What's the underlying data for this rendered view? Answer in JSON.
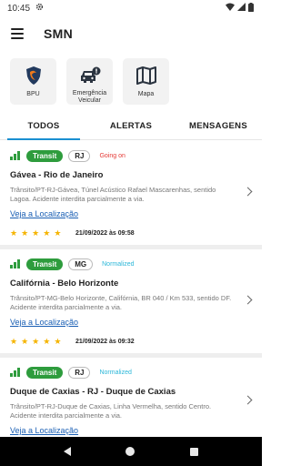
{
  "status_bar": {
    "time": "10:45"
  },
  "app": {
    "title": "SMN"
  },
  "shortcuts": [
    {
      "label": "BPU",
      "icon": "bpu-shield-icon"
    },
    {
      "label": "Emergência Veicular",
      "icon": "car-alert-icon"
    },
    {
      "label": "Mapa",
      "icon": "map-icon"
    }
  ],
  "tabs": [
    {
      "label": "TODOS",
      "active": true
    },
    {
      "label": "ALERTAS",
      "active": false
    },
    {
      "label": "MENSAGENS",
      "active": false
    }
  ],
  "cards": [
    {
      "badge": "Transit",
      "state": "RJ",
      "status": "Going on",
      "status_color": "#e53935",
      "title": "Gávea - Rio de Janeiro",
      "description": "Trânsito/PT-RJ-Gávea, Túnel Acústico Rafael Mascarenhas, sentido Lagoa. Acidente interdita parcialmente a via.",
      "link": "Veja a Localização",
      "rating": 5,
      "date": "21/09/2022 às 09:58"
    },
    {
      "badge": "Transit",
      "state": "MG",
      "status": "Normalized",
      "status_color": "#29b6d8",
      "title": "Califórnia - Belo Horizonte",
      "description": "Trânsito/PT-MG-Belo Horizonte, Califórnia, BR 040 / Km 533, sentido DF. Acidente interdita parcialmente a via.",
      "link": "Veja a Localização",
      "rating": 5,
      "date": "21/09/2022 às 09:32"
    },
    {
      "badge": "Transit",
      "state": "RJ",
      "status": "Normalized",
      "status_color": "#29b6d8",
      "title": "Duque de Caxias - RJ - Duque de Caxias",
      "description": "Trânsito/PT-RJ-Duque de Caxias, Linha Vermelha, sentido Centro. Acidente interdita parcialmente a via.",
      "link": "Veja a Localização"
    }
  ]
}
